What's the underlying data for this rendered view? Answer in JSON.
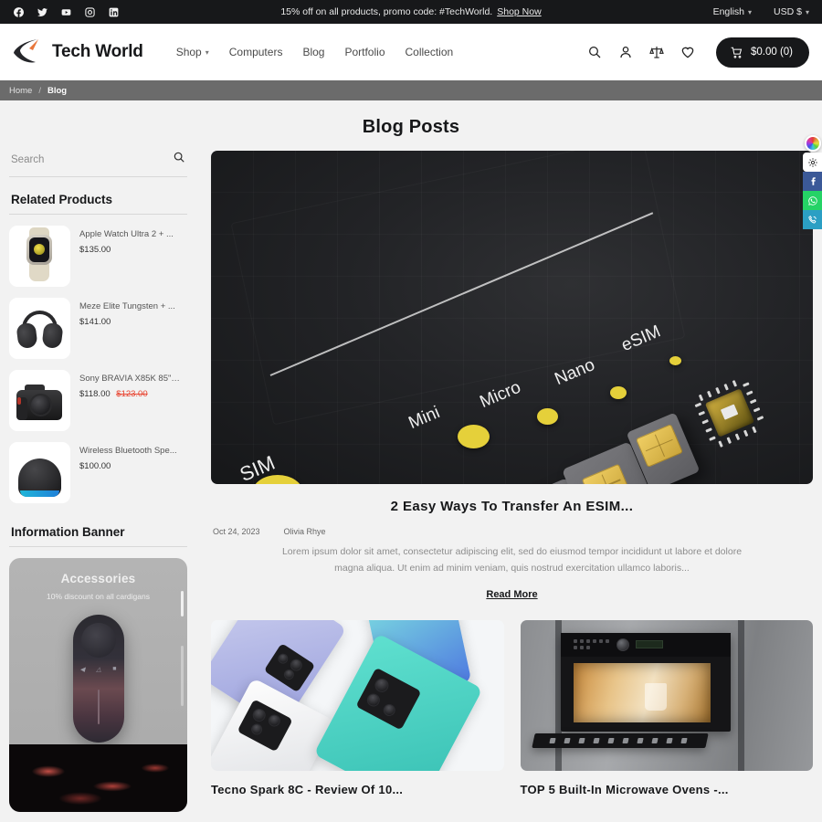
{
  "topbar": {
    "social": [
      {
        "name": "facebook-icon",
        "label": "Facebook"
      },
      {
        "name": "twitter-icon",
        "label": "Twitter"
      },
      {
        "name": "youtube-icon",
        "label": "YouTube"
      },
      {
        "name": "instagram-icon",
        "label": "Instagram"
      },
      {
        "name": "linkedin-icon",
        "label": "LinkedIn"
      }
    ],
    "promo_text": "15% off on all products, promo code: #TechWorld.",
    "promo_link": "Shop Now",
    "language": "English",
    "currency": "USD $"
  },
  "header": {
    "brand": "Tech World",
    "nav": [
      {
        "label": "Shop",
        "has_caret": true
      },
      {
        "label": "Computers",
        "has_caret": false
      },
      {
        "label": "Blog",
        "has_caret": false
      },
      {
        "label": "Portfolio",
        "has_caret": false
      },
      {
        "label": "Collection",
        "has_caret": false
      }
    ],
    "actions": [
      "search-icon",
      "account-icon",
      "compare-icon",
      "wishlist-icon"
    ],
    "cart_label": "$0.00 (0)"
  },
  "breadcrumb": {
    "home": "Home",
    "separator": "/",
    "current": "Blog"
  },
  "page": {
    "title": "Blog Posts"
  },
  "sidebar": {
    "search_placeholder": "Search",
    "related_title": "Related Products",
    "products": [
      {
        "name": "Apple Watch Ultra 2 + ...",
        "price": "$135.00",
        "old_price": ""
      },
      {
        "name": "Meze Elite Tungsten + ...",
        "price": "$141.00",
        "old_price": ""
      },
      {
        "name": "Sony BRAVIA X85K 85\" L...",
        "price": "$118.00",
        "old_price": "$123.00"
      },
      {
        "name": "Wireless Bluetooth Spe...",
        "price": "$100.00",
        "old_price": ""
      }
    ],
    "banner_title": "Information Banner",
    "banner": {
      "heading": "Accessories",
      "subheading": "10% discount on all cardigans"
    }
  },
  "main": {
    "featured": {
      "hero_labels": [
        "SIM",
        "Mini",
        "Micro",
        "Nano",
        "eSIM"
      ],
      "title": "2 Easy Ways To Transfer An ESIM...",
      "date": "Oct 24, 2023",
      "author": "Olivia Rhye",
      "excerpt": "Lorem ipsum dolor sit amet, consectetur adipiscing elit, sed do eiusmod tempor incididunt ut labore et dolore magna aliqua. Ut enim ad minim veniam, quis nostrud exercitation ullamco laboris...",
      "read_more": "Read More"
    },
    "cards": [
      {
        "title": "Tecno Spark 8C - Review Of 10..."
      },
      {
        "title": "TOP 5 Built-In Microwave Ovens -..."
      }
    ]
  },
  "floating": {
    "buttons": [
      {
        "name": "color-wheel-icon"
      },
      {
        "name": "settings-gear-icon"
      },
      {
        "name": "facebook-share-icon"
      },
      {
        "name": "whatsapp-share-icon"
      },
      {
        "name": "viber-call-icon"
      }
    ]
  },
  "colors": {
    "dark": "#17181a",
    "accent_orange": "#e8763a",
    "sale_red": "#e8422e",
    "facebook": "#3b5998",
    "whatsapp": "#25d366",
    "viber": "#2b9fc4"
  }
}
